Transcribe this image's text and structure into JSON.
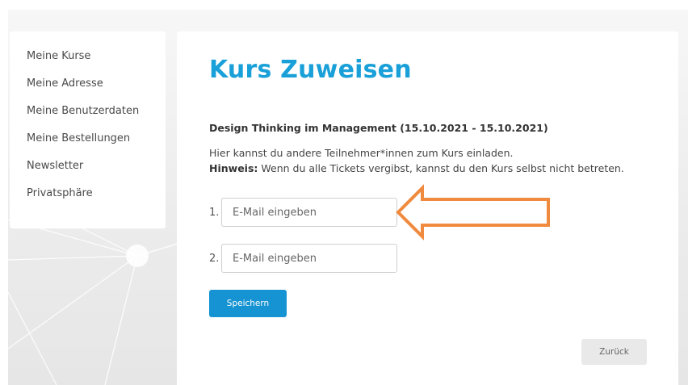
{
  "sidebar": {
    "items": [
      {
        "label": "Meine Kurse"
      },
      {
        "label": "Meine Adresse"
      },
      {
        "label": "Meine Benutzerdaten"
      },
      {
        "label": "Meine Bestellungen"
      },
      {
        "label": "Newsletter"
      },
      {
        "label": "Privatsphäre"
      }
    ]
  },
  "main": {
    "title": "Kurs Zuweisen",
    "course": "Design Thinking im Management (15.10.2021 - 15.10.2021)",
    "description": "Hier kannst du andere Teilnehmer*innen zum Kurs einladen.",
    "hint_label": "Hinweis:",
    "hint_text": " Wenn du alle Tickets vergibst, kannst du den Kurs selbst nicht betreten.",
    "fields": [
      {
        "number": "1.",
        "value": "",
        "placeholder": "E-Mail eingeben"
      },
      {
        "number": "2.",
        "value": "",
        "placeholder": "E-Mail eingeben"
      }
    ],
    "save_label": "Speichern",
    "back_label": "Zurück"
  },
  "colors": {
    "title": "#1aa0d8",
    "save_button": "#1593d2",
    "arrow": "#f08a3e",
    "back_button": "#e9e9e9"
  },
  "icons": [
    "arrow-pointer-icon"
  ]
}
